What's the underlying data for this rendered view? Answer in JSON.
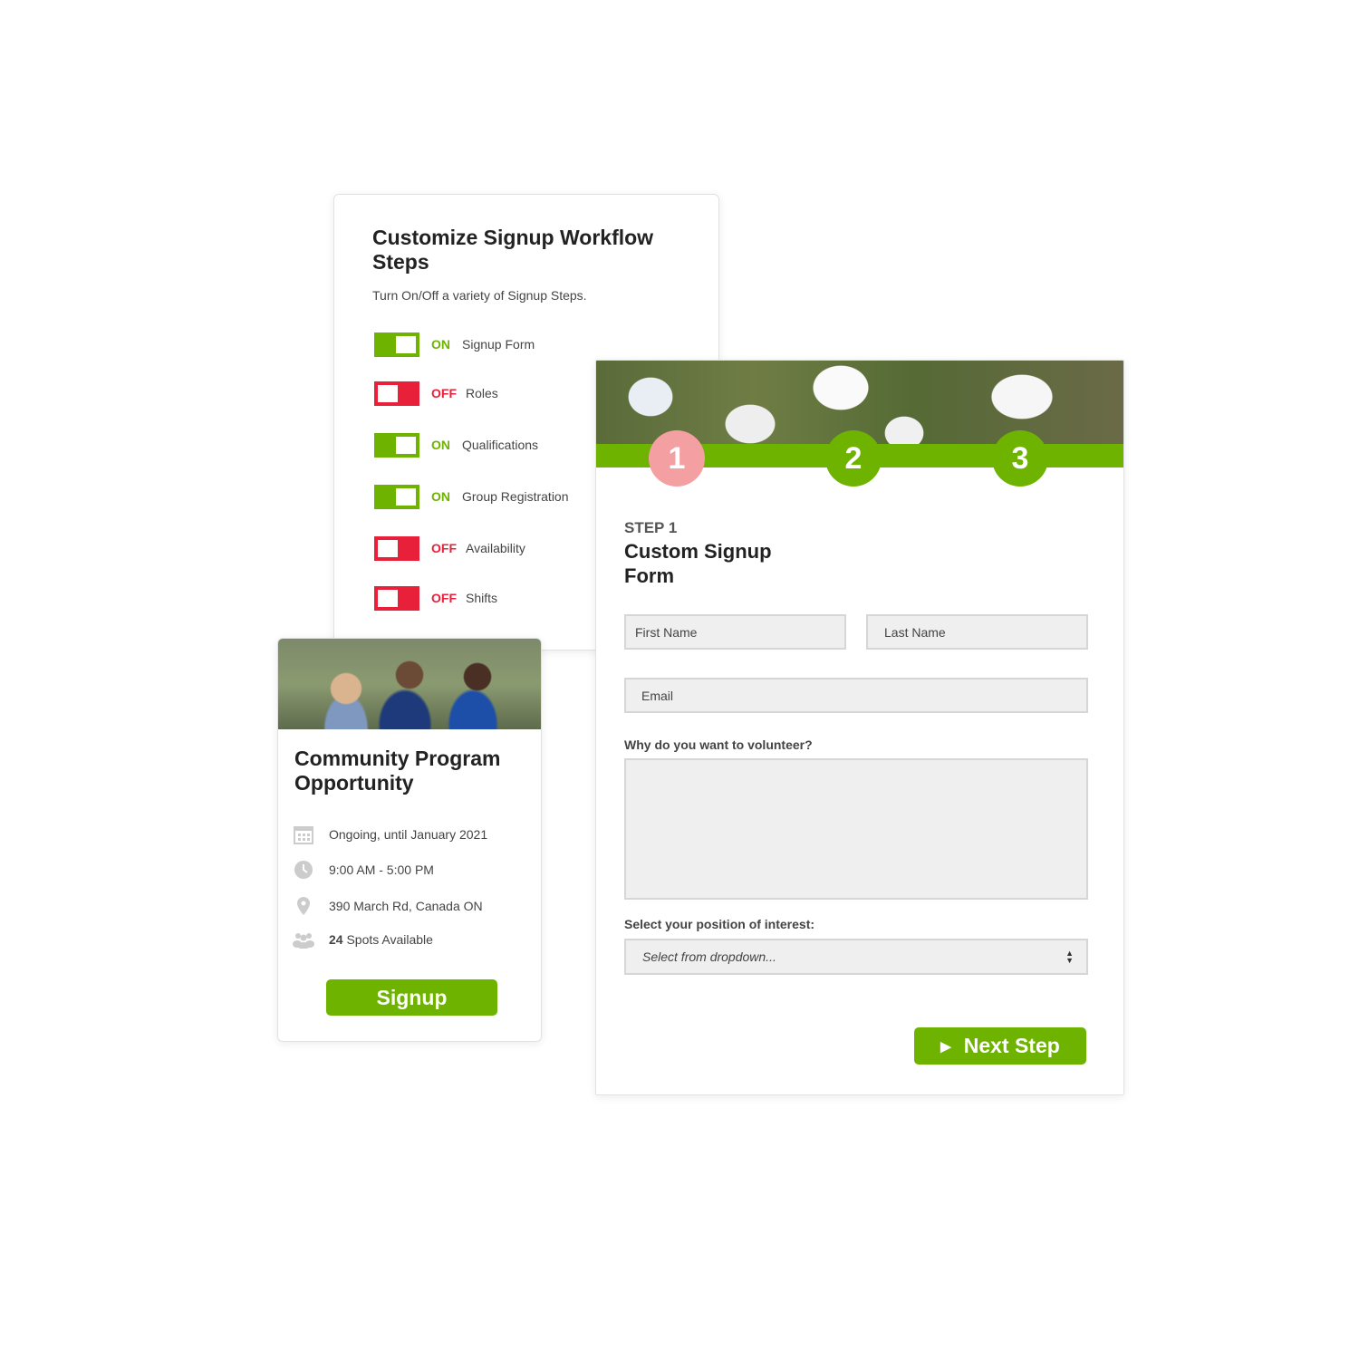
{
  "workflow": {
    "title": "Customize Signup Workflow Steps",
    "subtitle": "Turn On/Off a variety of Signup Steps.",
    "steps": [
      {
        "state": "ON",
        "label": "Signup Form",
        "on": true
      },
      {
        "state": "OFF",
        "label": "Roles",
        "on": false
      },
      {
        "state": "ON",
        "label": "Qualifications",
        "on": true
      },
      {
        "state": "ON",
        "label": "Group Registration",
        "on": true
      },
      {
        "state": "OFF",
        "label": "Availability",
        "on": false
      },
      {
        "state": "OFF",
        "label": "Shifts",
        "on": false
      }
    ]
  },
  "form": {
    "steps": [
      "1",
      "2",
      "3"
    ],
    "active_step": 1,
    "step_label": "STEP 1",
    "title": "Custom Signup Form",
    "first_name_placeholder": "First Name",
    "last_name_placeholder": "Last Name",
    "email_placeholder": "Email",
    "why_label": "Why do you want to volunteer?",
    "position_label": "Select your position of interest:",
    "position_placeholder": "Select from dropdown...",
    "next_label": "Next Step"
  },
  "opportunity": {
    "title": "Community Program Opportunity",
    "date": "Ongoing, until January 2021",
    "time": "9:00 AM - 5:00 PM",
    "location": "390 March Rd, Canada ON",
    "spots_count": "24",
    "spots_text": " Spots Available",
    "signup_label": "Signup"
  },
  "colors": {
    "accent": "#6db300",
    "off": "#e8203a",
    "active_step": "#f4a0a3"
  }
}
